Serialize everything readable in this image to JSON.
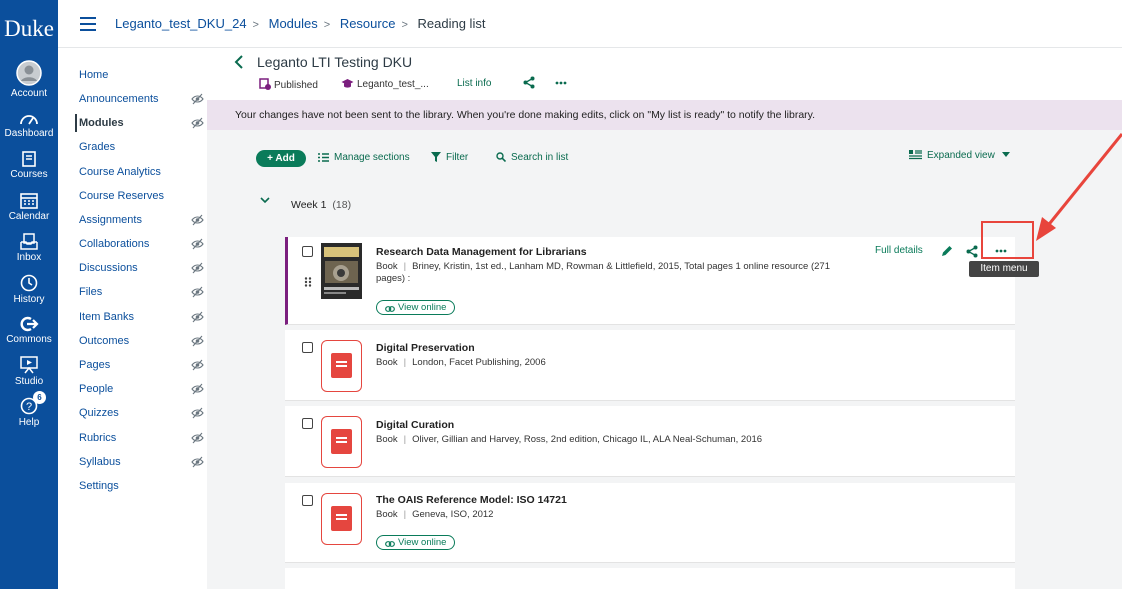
{
  "global_nav": {
    "logo": "Duke",
    "items": [
      {
        "label": "Account",
        "icon": "account-icon"
      },
      {
        "label": "Dashboard",
        "icon": "dashboard-icon"
      },
      {
        "label": "Courses",
        "icon": "courses-icon"
      },
      {
        "label": "Calendar",
        "icon": "calendar-icon"
      },
      {
        "label": "Inbox",
        "icon": "inbox-icon"
      },
      {
        "label": "History",
        "icon": "history-icon"
      },
      {
        "label": "Commons",
        "icon": "commons-icon"
      },
      {
        "label": "Studio",
        "icon": "studio-icon"
      },
      {
        "label": "Help",
        "icon": "help-icon",
        "badge": "6"
      }
    ]
  },
  "breadcrumb": {
    "items": [
      "Leganto_test_DKU_24",
      "Modules",
      "Resource",
      "Reading list"
    ]
  },
  "course_nav": {
    "items": [
      "Home",
      "Announcements",
      "Modules",
      "Grades",
      "Course Analytics",
      "Course Reserves",
      "Assignments",
      "Collaborations",
      "Discussions",
      "Files",
      "Item Banks",
      "Outcomes",
      "Pages",
      "People",
      "Quizzes",
      "Rubrics",
      "Syllabus",
      "Settings"
    ],
    "active": "Modules"
  },
  "list": {
    "title": "Leganto LTI Testing DKU",
    "status": "Published",
    "course": "Leganto_test_...",
    "list_info": "List info"
  },
  "banner": "Your changes have not been sent to the library. When you're done making edits, click on \"My list is ready\" to notify the library.",
  "toolbar": {
    "add": "+ Add",
    "manage_sections": "Manage sections",
    "filter": "Filter",
    "search": "Search in list",
    "view": "Expanded view"
  },
  "section": {
    "name": "Week 1",
    "count": "(18)"
  },
  "items": [
    {
      "title": "Research Data Management for Librarians",
      "type": "Book",
      "details": "Briney, Kristin, 1st ed., Lanham MD, Rowman & Littlefield, 2015, Total pages 1 online resource (271 pages) :",
      "view_online": "View online"
    },
    {
      "title": "Digital Preservation",
      "type": "Book",
      "details": "London, Facet Publishing, 2006"
    },
    {
      "title": "Digital Curation",
      "type": "Book",
      "details": "Oliver, Gillian and Harvey, Ross, 2nd edition, Chicago IL, ALA Neal-Schuman, 2016"
    },
    {
      "title": "The OAIS Reference Model: ISO 14721",
      "type": "Book",
      "details": "Geneva, ISO, 2012",
      "view_online": "View online"
    }
  ],
  "item_actions": {
    "full_details": "Full details",
    "tooltip": "Item menu"
  },
  "colors": {
    "global_nav": "#0b4f9c",
    "accent_green": "#0a7b5a",
    "banner": "#ece2ee",
    "selected_bar": "#7b1f7e",
    "annotation": "#e8453c"
  }
}
